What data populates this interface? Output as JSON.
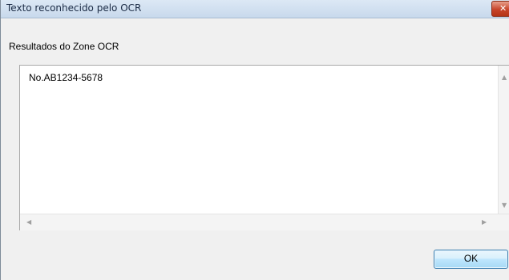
{
  "window": {
    "title": "Texto reconhecido pelo OCR",
    "close_glyph": "✕",
    "close_icon": "close-icon"
  },
  "main": {
    "group_label": "Resultados do Zone OCR",
    "ocr_text": "No.AB1234-5678"
  },
  "scrollbars": {
    "up_icon": "scroll-up-arrow-icon",
    "down_icon": "scroll-down-arrow-icon",
    "left_icon": "scroll-left-arrow-icon",
    "right_icon": "scroll-right-arrow-icon"
  },
  "buttons": {
    "ok_label": "OK"
  },
  "colors": {
    "dialog_background": "#f0f0f0",
    "title_bar": "#dce8f5",
    "close_button": "#c7442a",
    "ok_button_border": "#3c7fb1"
  }
}
